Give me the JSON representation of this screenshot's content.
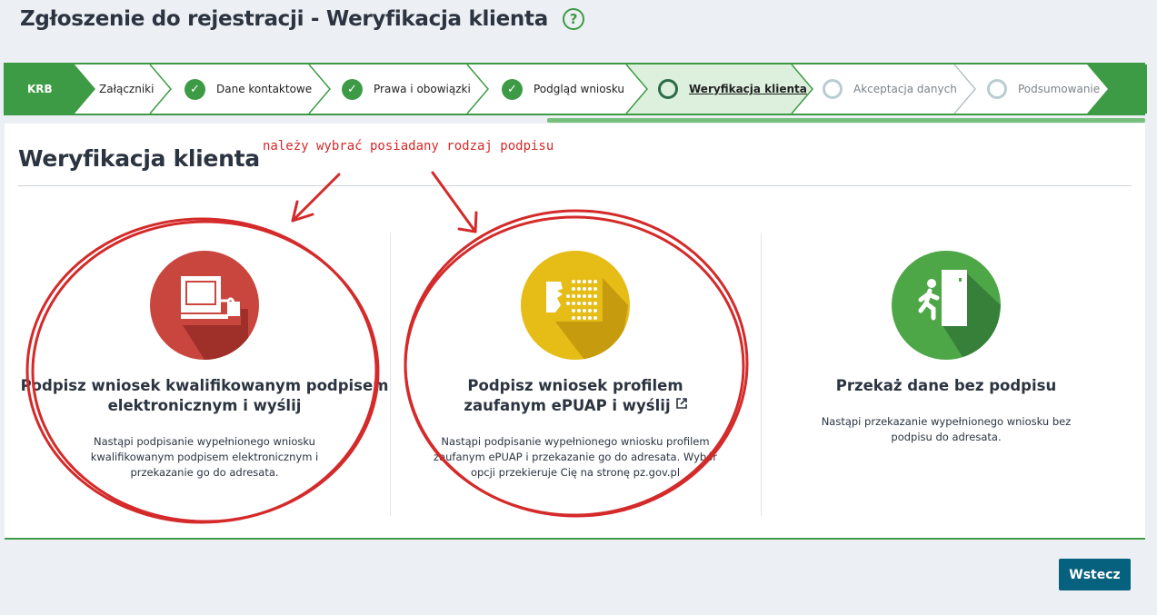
{
  "header": {
    "title": "Zgłoszenie do rejestracji - Weryfikacja klienta",
    "help_icon": "?"
  },
  "stepper": {
    "steps": [
      {
        "label": "KRB",
        "state": "first"
      },
      {
        "label": "Załączniki",
        "state": "plain"
      },
      {
        "label": "Dane kontaktowe",
        "state": "done"
      },
      {
        "label": "Prawa i obowiązki",
        "state": "done"
      },
      {
        "label": "Podgląd wniosku",
        "state": "done"
      },
      {
        "label": "Weryfikacja klienta",
        "state": "active"
      },
      {
        "label": "Akceptacja danych",
        "state": "pending"
      },
      {
        "label": "Podsumowanie",
        "state": "pending"
      }
    ]
  },
  "section": {
    "title": "Weryfikacja klienta"
  },
  "annotation": {
    "text": "należy wybrać posiadany rodzaj podpisu",
    "color": "#d42a2a"
  },
  "options": [
    {
      "title": "Podpisz wniosek kwalifikowanym podpisem elektronicznym i wyślij",
      "description": "Nastąpi podpisanie wypełnionego wniosku kwalifikowanym podpisem elektronicznym i przekazanie go do adresata.",
      "icon": "computer-signature-icon",
      "color": "#c9463f"
    },
    {
      "title": "Podpisz wniosek profilem zaufanym ePUAP i wyślij",
      "description": "Nastąpi podpisanie wypełnionego wniosku profilem zaufanym ePUAP i przekazanie go do adresata. Wybór opcji przekieruje Cię na stronę pz.gov.pl",
      "icon": "face-id-icon",
      "color": "#e6bc17"
    },
    {
      "title": "Przekaż dane bez podpisu",
      "description": "Nastąpi przekazanie wypełnionego wniosku bez podpisu do adresata.",
      "icon": "person-exit-icon",
      "color": "#4ea747"
    }
  ],
  "footer": {
    "back_label": "Wstecz"
  },
  "colors": {
    "accent": "#3e9b45",
    "button": "#06617e"
  }
}
